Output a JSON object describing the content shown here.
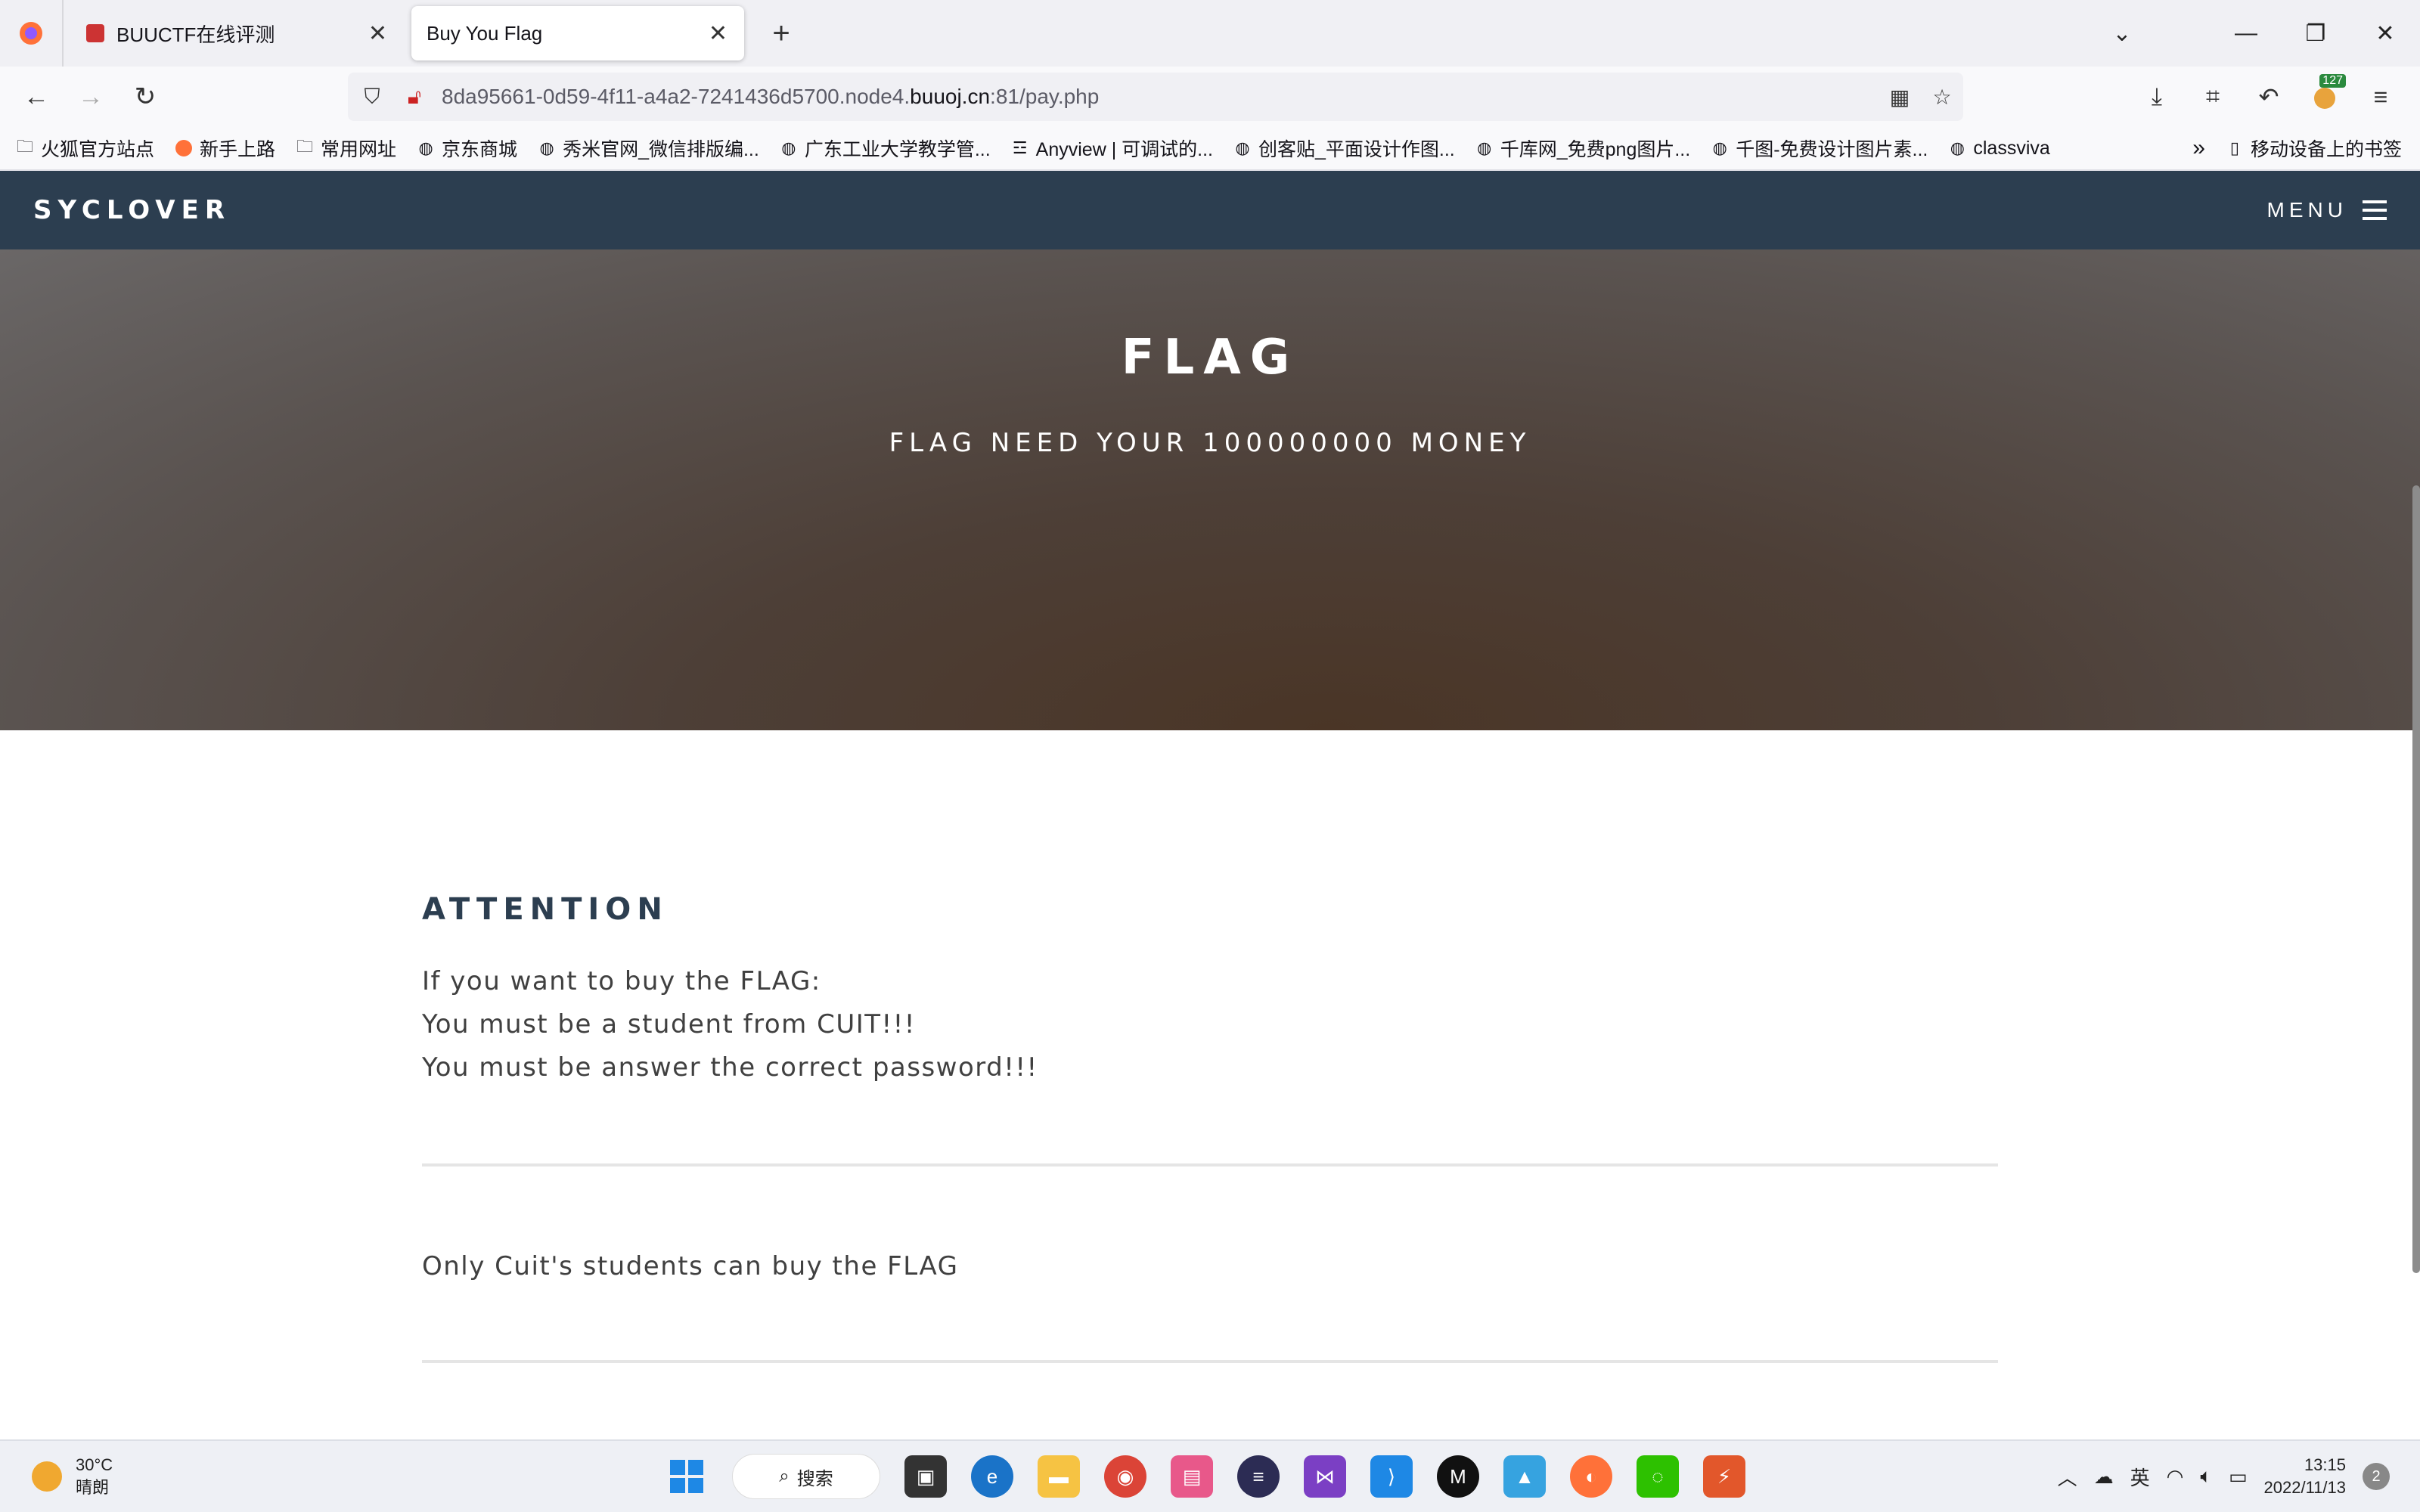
{
  "browser": {
    "tabs": [
      {
        "title": "BUUCTF在线评测",
        "active": false
      },
      {
        "title": "Buy You Flag",
        "active": true
      }
    ],
    "url": {
      "prefix": "8da95661-0d59-4f11-a4a2-7241436d5700.node4.",
      "host": "buuoj.cn",
      "suffix": ":81/pay.php"
    },
    "extension_badge": "127",
    "bookmarks": [
      {
        "label": "火狐官方站点",
        "icon": "folder-icon"
      },
      {
        "label": "新手上路",
        "icon": "firefox-icon"
      },
      {
        "label": "常用网址",
        "icon": "folder-icon"
      },
      {
        "label": "京东商城",
        "icon": "globe-icon"
      },
      {
        "label": "秀米官网_微信排版编...",
        "icon": "globe-icon"
      },
      {
        "label": "广东工业大学教学管...",
        "icon": "globe-icon"
      },
      {
        "label": "Anyview | 可调试的...",
        "icon": "anyview-icon"
      },
      {
        "label": "创客贴_平面设计作图...",
        "icon": "globe-icon"
      },
      {
        "label": "千库网_免费png图片...",
        "icon": "globe-icon"
      },
      {
        "label": "千图-免费设计图片素...",
        "icon": "globe-icon"
      },
      {
        "label": "classviva",
        "icon": "globe-icon"
      }
    ],
    "mobile_bookmarks": "移动设备上的书签"
  },
  "site": {
    "brand": "SYCLOVER",
    "menu_label": "MENU",
    "hero_title": "FLAG",
    "hero_subtitle": "FLAG NEED YOUR 100000000 MONEY",
    "section_heading": "ATTENTION",
    "lines": [
      "If you want to buy the FLAG:",
      "You must be a student from CUIT!!!",
      "You must be answer the correct password!!!"
    ],
    "note": "Only Cuit's students can buy the FLAG"
  },
  "taskbar": {
    "weather_temp": "30°C",
    "weather_desc": "晴朗",
    "search_label": "搜索",
    "ime": "英",
    "time": "13:15",
    "date": "2022/11/13",
    "notifications": "2"
  },
  "colors": {
    "navbar_bg": "#2c3e50",
    "heading": "#2c3e50",
    "body_text": "#404040"
  }
}
